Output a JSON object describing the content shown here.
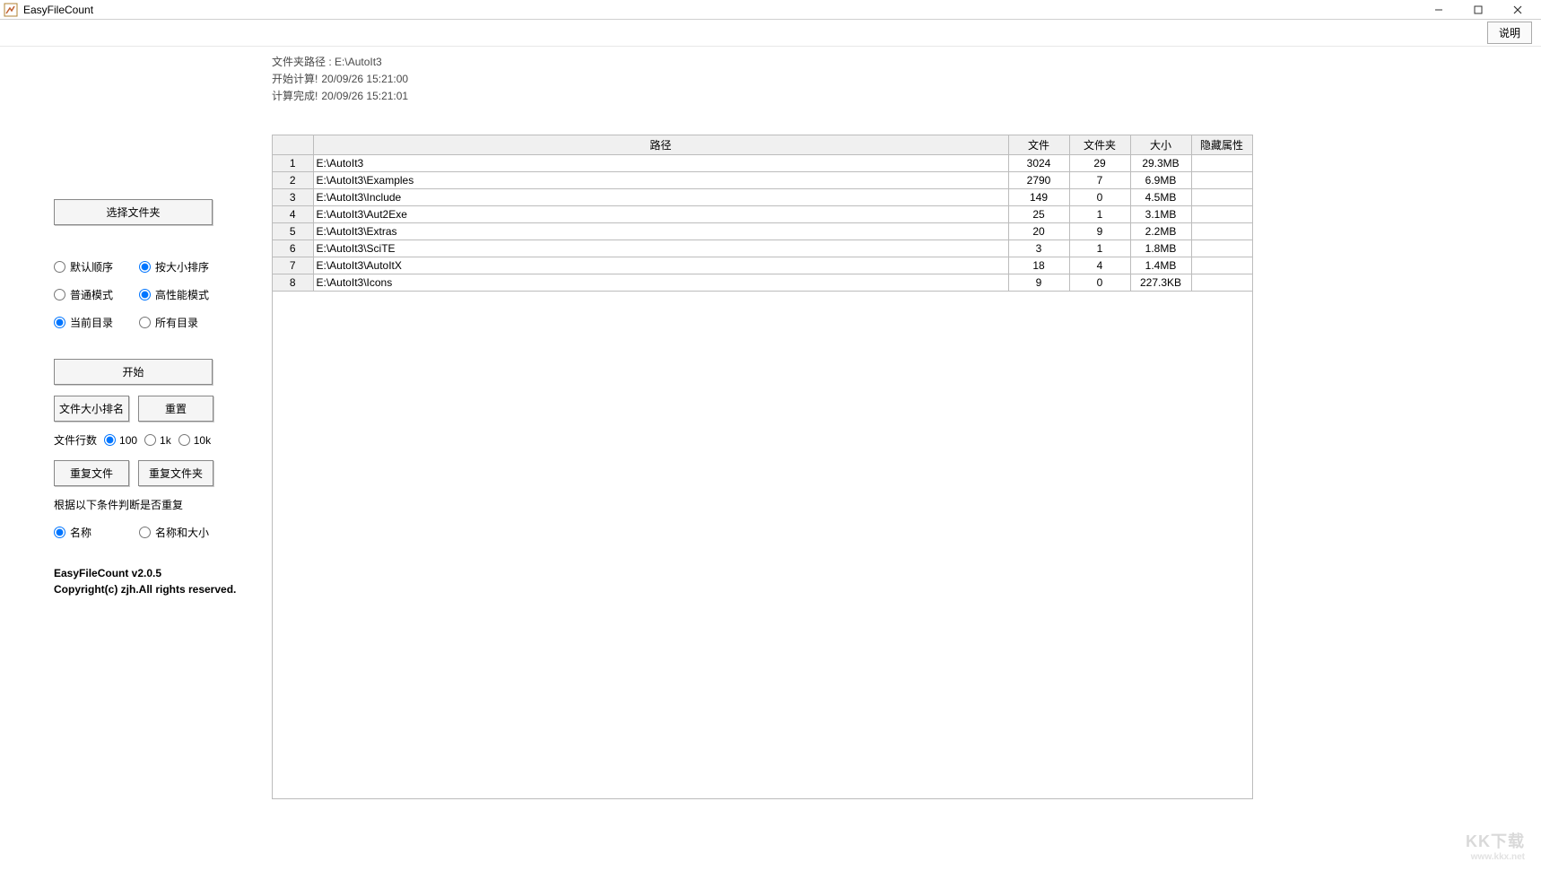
{
  "window": {
    "title": "EasyFileCount"
  },
  "toolbar": {
    "help_label": "说明"
  },
  "info": {
    "path_label": "文件夹路径 :",
    "path_value": "E:\\AutoIt3",
    "start_label": "开始计算!",
    "start_time": "20/09/26 15:21:00",
    "done_label": "计算完成!",
    "done_time": "20/09/26 15:21:01"
  },
  "sidebar": {
    "select_folder_label": "选择文件夹",
    "order": {
      "default": "默认顺序",
      "by_size": "按大小排序"
    },
    "mode": {
      "normal": "普通模式",
      "high_perf": "高性能模式"
    },
    "scope": {
      "current": "当前目录",
      "all": "所有目录"
    },
    "start_label": "开始",
    "sort_by_size_label": "文件大小排名",
    "reset_label": "重置",
    "line_count_label": "文件行数",
    "line_count_options": {
      "o100": "100",
      "o1k": "1k",
      "o10k": "10k"
    },
    "dup_file_label": "重复文件",
    "dup_folder_label": "重复文件夹",
    "dup_criteria_label": "根据以下条件判断是否重复",
    "dup_criteria": {
      "name": "名称",
      "name_size": "名称和大小"
    },
    "version_line": "EasyFileCount v2.0.5",
    "copyright_line": "Copyright(c) zjh.All rights reserved."
  },
  "table": {
    "headers": {
      "rownum": "",
      "path": "路径",
      "files": "文件",
      "folders": "文件夹",
      "size": "大小",
      "hidden": "隐藏属性"
    },
    "rows": [
      {
        "n": "1",
        "path": "E:\\AutoIt3",
        "files": "3024",
        "folders": "29",
        "size": "29.3MB",
        "hidden": ""
      },
      {
        "n": "2",
        "path": "E:\\AutoIt3\\Examples",
        "files": "2790",
        "folders": "7",
        "size": "6.9MB",
        "hidden": ""
      },
      {
        "n": "3",
        "path": "E:\\AutoIt3\\Include",
        "files": "149",
        "folders": "0",
        "size": "4.5MB",
        "hidden": ""
      },
      {
        "n": "4",
        "path": "E:\\AutoIt3\\Aut2Exe",
        "files": "25",
        "folders": "1",
        "size": "3.1MB",
        "hidden": ""
      },
      {
        "n": "5",
        "path": "E:\\AutoIt3\\Extras",
        "files": "20",
        "folders": "9",
        "size": "2.2MB",
        "hidden": ""
      },
      {
        "n": "6",
        "path": "E:\\AutoIt3\\SciTE",
        "files": "3",
        "folders": "1",
        "size": "1.8MB",
        "hidden": ""
      },
      {
        "n": "7",
        "path": "E:\\AutoIt3\\AutoItX",
        "files": "18",
        "folders": "4",
        "size": "1.4MB",
        "hidden": ""
      },
      {
        "n": "8",
        "path": "E:\\AutoIt3\\Icons",
        "files": "9",
        "folders": "0",
        "size": "227.3KB",
        "hidden": ""
      }
    ]
  },
  "watermark": {
    "main": "KK下载",
    "sub": "www.kkx.net"
  }
}
